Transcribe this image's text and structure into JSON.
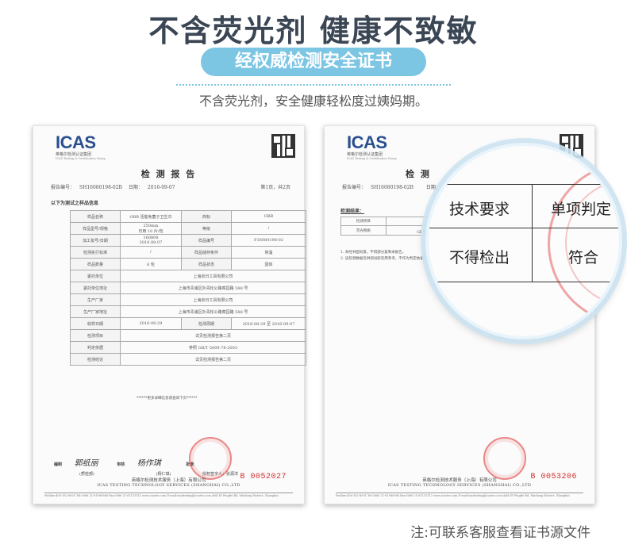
{
  "header": {
    "headline": "不含荧光剂 健康不致敏",
    "pill": "经权威检测安全证书",
    "subtitle": "不含荧光剂，安全健康轻松度过姨妈期。"
  },
  "left_cert": {
    "logo": "ICAS",
    "logo_band": "英格尔检测认证集团",
    "logo_tiny": "ICAS Testing & Certification Group",
    "title": "检 测 报 告",
    "report_no_label": "报告编号：",
    "report_no": "SH16080198-02B",
    "date_label": "日期：",
    "date": "2016-09-07",
    "page": "第1页，共2页",
    "section_label": "以下为测试之样品信息",
    "rows": [
      [
        "样品名称",
        "OBB 活能免菌子卫生巾",
        "商标",
        "OBB"
      ],
      [
        "样品型号/规格",
        "250mm\n日用 10 片/包",
        "等级",
        "/"
      ],
      [
        "加工批号/日期",
        "160808\n2016.08.07",
        "样品编号",
        "F16080198-02"
      ],
      [
        "检测执行标准",
        "/",
        "样品储存条件",
        "常温"
      ],
      [
        "样品数量",
        "6 包",
        "样品状态",
        "固体"
      ],
      [
        "委托单位",
        "上海京日工贸有限公司"
      ],
      [
        "委托单位地址",
        "上海市青浦区外青松公路菜园路 588 号"
      ],
      [
        "生产厂家",
        "上海京日工贸有限公司"
      ],
      [
        "生产厂家地址",
        "上海市青浦区外青松公路菜园路 588 号"
      ],
      [
        "收样日期",
        "2016-08-29",
        "检测周期",
        "2016-08-29 至 2016-09-07"
      ],
      [
        "检测项目",
        "详见检测报告第二页"
      ],
      [
        "判定依据",
        "参照 GB/T 5009.78-2003"
      ],
      [
        "检测结论",
        "详见检测报告第二页"
      ]
    ],
    "footnote": "******更多详细信息请查阅下页******",
    "sign_compile": "编制",
    "sign_review": "审核",
    "sign_approve": "批准",
    "signer_compile_hand": "郭纸丽",
    "signer_review_hand": "杨作琪",
    "signer_compile_role": "(质检部)",
    "signer_review_role": "(杨仁琪)",
    "authorized": "授权签字人：张源洋",
    "footer_cn": "英格尔检测技术服务（上海）有限公司",
    "footer_en": "ICAS TESTING TECHNOLOGY SERVICES (SHANGHAI) CO.,LTD",
    "footer_strip": "Hotline:400-182-8001  Tel:0086 21-61980988  Fax:0086 21-61115112  www.icastes.com  E-mail:marketing@icastes.com  Add:1F Pingfei Rd, Minhang District, Shanghai",
    "serial": "B 0052027"
  },
  "right_cert": {
    "logo": "ICAS",
    "logo_band": "英格尔检测认证集团",
    "logo_tiny": "ICAS Testing & Certification Group",
    "title": "检 测",
    "report_no_label": "报告编号：",
    "report_no": "SH16080198-02B",
    "date_label": "日期：",
    "results_label": "检测结果：",
    "mini_headers": [
      "检测项目",
      "检测方法"
    ],
    "mini_row": [
      "荧光物质",
      "参照\nGB/T 5009.78-2003"
    ],
    "notes": [
      "1. 未经书面同意，不得部分复制本报告。",
      "2. 该检测数据仅供测试研究用参考，不作为判定依据。"
    ],
    "footer_cn": "英格尔检测技术服务（上海）有限公司",
    "footer_en": "ICAS TESTING TECHNOLOGY SERVICES (SHANGHAI) CO.,LTD",
    "footer_strip": "Hotline:400-182-8001  Tel:0086 21-61980988  Fax:0086 21-61115112  www.icastes.com  E-mail:marketing@icastes.com  Add:1F Pingfei Rd, Minhang District, Shanghai",
    "serial": "B 0053206"
  },
  "magnifier": {
    "tech_req": "技术要求",
    "item_judge": "单项判定",
    "not_detected": "不得检出",
    "conform": "符合"
  },
  "note": "注:可联系客服查看证书源文件"
}
